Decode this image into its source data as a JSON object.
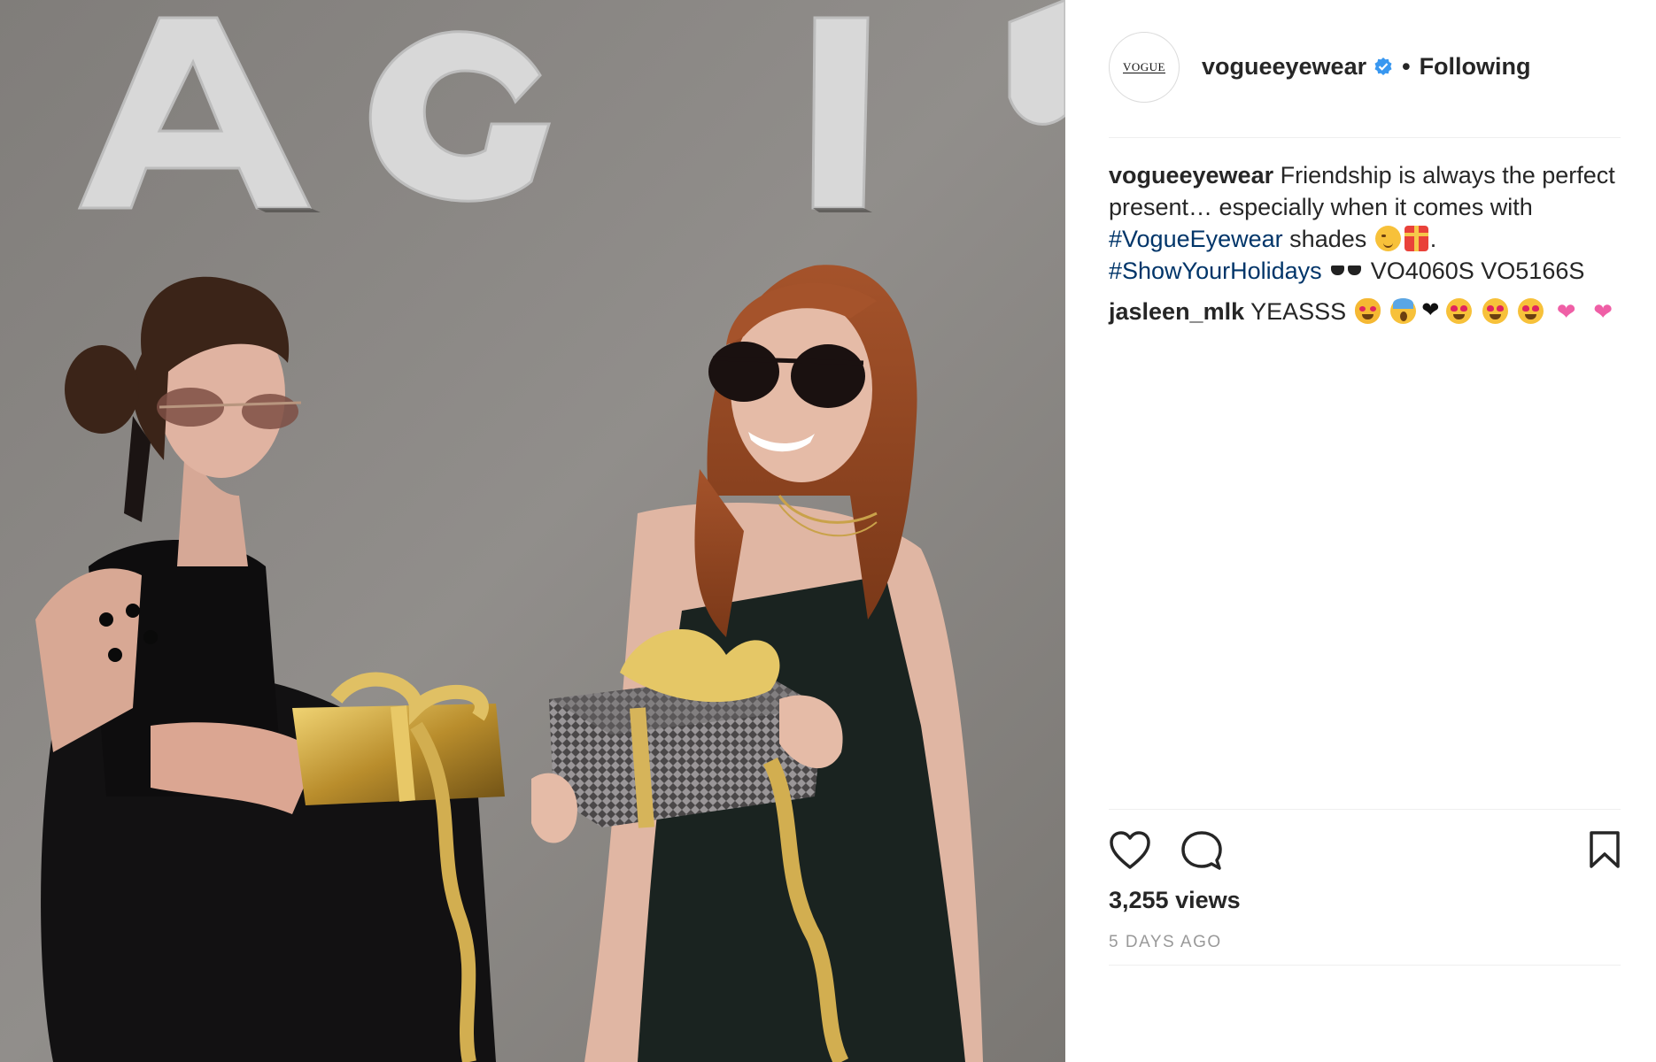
{
  "post": {
    "image": {
      "alt": "Two women exchanging wrapped gifts",
      "wall_letters": "AGIC"
    },
    "header": {
      "avatar_text": "VOGUE",
      "username": "vogueeyewear",
      "verified": true,
      "separator": "•",
      "follow_state": "Following"
    },
    "caption": {
      "username": "vogueeyewear",
      "text_1": "Friendship is always the perfect present… especially when it comes with",
      "hashtag_1": "#VogueEyewear",
      "text_2": "shades",
      "text_3": ".",
      "hashtag_2": "#ShowYourHolidays",
      "text_4": "VO4060S VO5166S",
      "emojis": [
        "wink-emoji",
        "gift-emoji",
        "sunglasses-emoji"
      ]
    },
    "comments": [
      {
        "username": "jasleen_mlk",
        "text": "YEASSS",
        "emojis": [
          "heart-eyes-cat-emoji",
          "scream-emoji",
          "black-heart-emoji",
          "heart-eyes-emoji",
          "heart-eyes-emoji",
          "heart-eyes-emoji",
          "growing-heart-emoji",
          "growing-heart-emoji"
        ]
      }
    ],
    "actions": {
      "icons": [
        "heart-icon",
        "comment-icon",
        "bookmark-icon"
      ]
    },
    "views": "3,255 views",
    "timestamp": "5 DAYS AGO"
  },
  "colors": {
    "text": "#262626",
    "hashtag": "#003569",
    "muted": "#999999",
    "verified": "#3897f0",
    "divider": "#efefef"
  }
}
